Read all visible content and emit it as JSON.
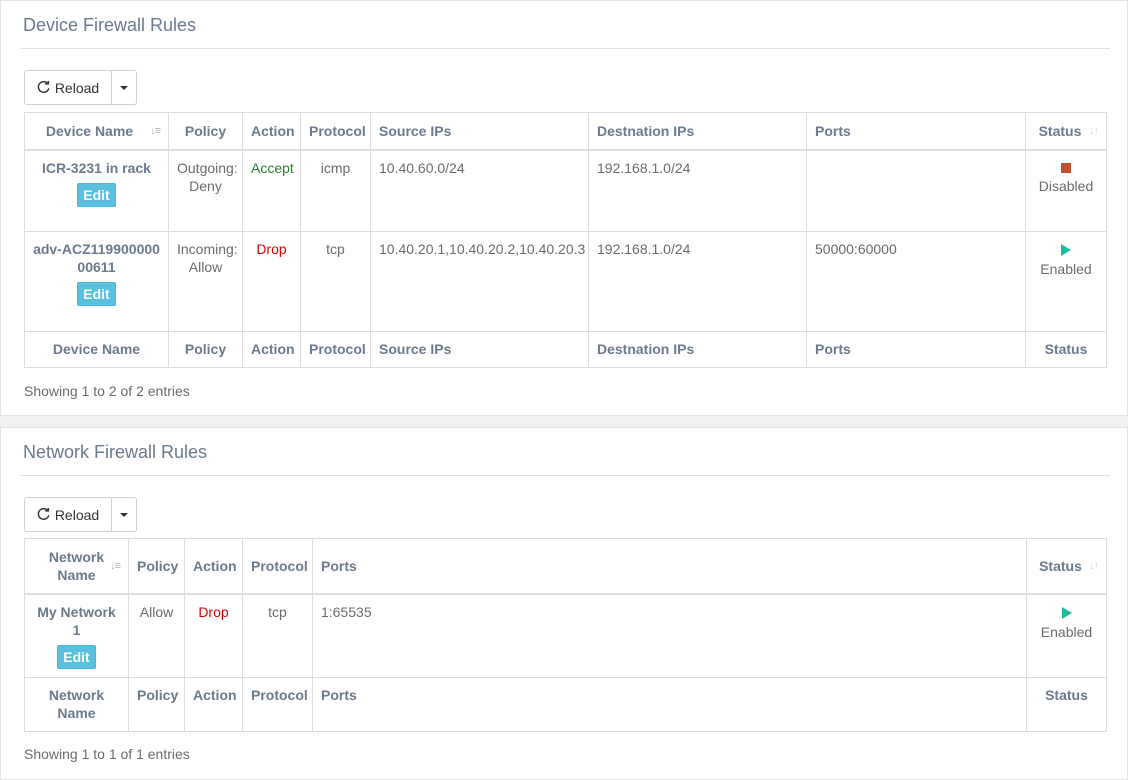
{
  "device_panel": {
    "title": "Device Firewall Rules",
    "reload_label": "Reload",
    "headers": [
      "Device Name",
      "Policy",
      "Action",
      "Protocol",
      "Source IPs",
      "Destnation IPs",
      "Ports",
      "Status"
    ],
    "rows": [
      {
        "name": "ICR-3231 in rack",
        "edit_label": "Edit",
        "policy_line1": "Outgoing:",
        "policy_line2": "Deny",
        "action": "Accept",
        "protocol": "icmp",
        "source_ips": "10.40.60.0/24",
        "dest_ips": "192.168.1.0/24",
        "ports": "",
        "status": "Disabled"
      },
      {
        "name": "adv-ACZ11990000000611",
        "edit_label": "Edit",
        "policy_line1": "Incoming:",
        "policy_line2": "Allow",
        "action": "Drop",
        "protocol": "tcp",
        "source_ips": "10.40.20.1,10.40.20.2,10.40.20.3",
        "dest_ips": "192.168.1.0/24",
        "ports": "50000:60000",
        "status": "Enabled"
      }
    ],
    "info": "Showing 1 to 2 of 2 entries"
  },
  "network_panel": {
    "title": "Network Firewall Rules",
    "reload_label": "Reload",
    "headers": [
      "Network Name",
      "Policy",
      "Action",
      "Protocol",
      "Ports",
      "Status"
    ],
    "rows": [
      {
        "name": "My Network 1",
        "edit_label": "Edit",
        "policy": "Allow",
        "action": "Drop",
        "protocol": "tcp",
        "ports": "1:65535",
        "status": "Enabled"
      }
    ],
    "info": "Showing 1 to 1 of 1 entries"
  },
  "colors": {
    "accept": "#2e7d32",
    "drop": "#e00000",
    "disabled_icon": "#c2512f",
    "enabled_icon": "#1abc9c",
    "edit_button": "#5bc0de"
  },
  "icons": {
    "reload": "refresh-icon",
    "caret": "caret-down-icon",
    "sort": "sort-icon",
    "disabled": "stop-square-icon",
    "enabled": "play-triangle-icon"
  }
}
